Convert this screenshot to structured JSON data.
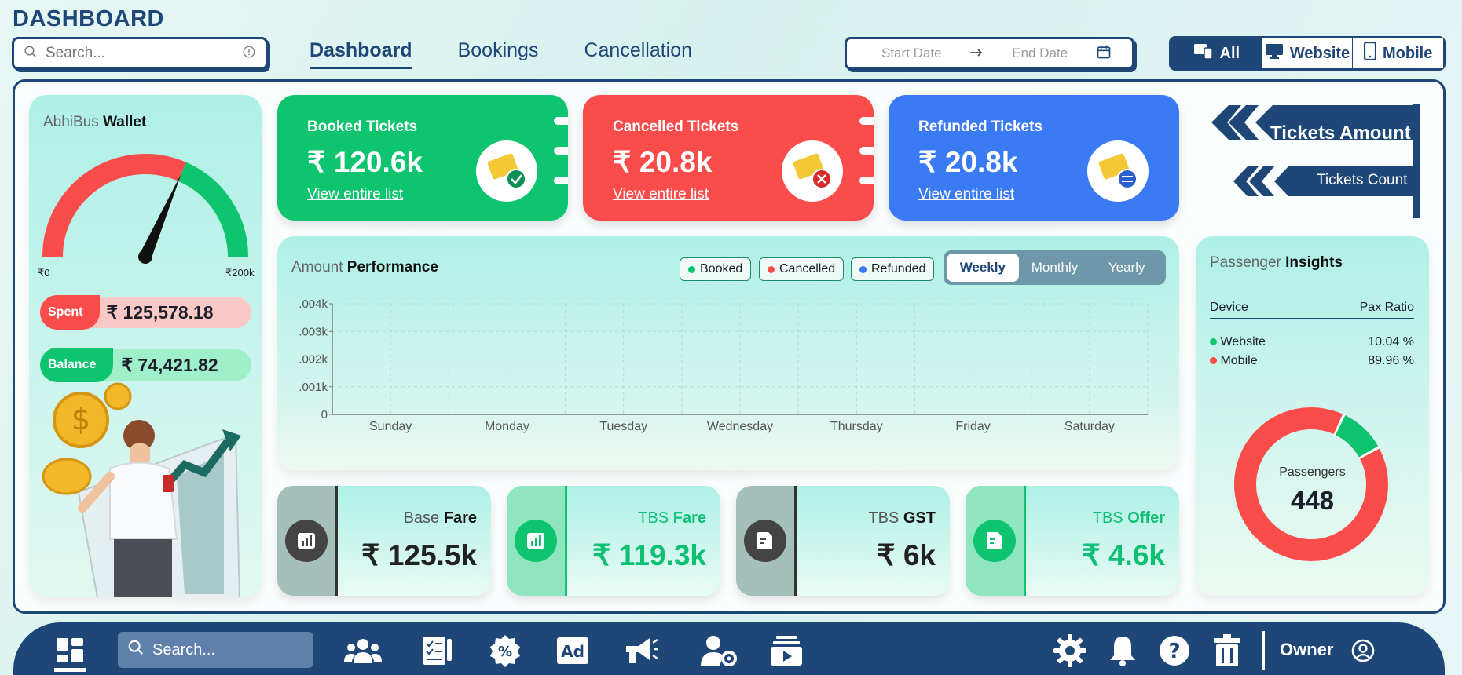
{
  "header": {
    "title": "DASHBOARD",
    "search_placeholder": "Search...",
    "tabs": [
      {
        "label": "Dashboard",
        "active": true
      },
      {
        "label": "Bookings",
        "active": false
      },
      {
        "label": "Cancellation",
        "active": false
      }
    ],
    "start_date_placeholder": "Start Date",
    "end_date_placeholder": "End Date",
    "source_filter": [
      {
        "label": "All",
        "icon": "devices-icon",
        "active": true
      },
      {
        "label": "Website",
        "icon": "monitor-icon",
        "active": false
      },
      {
        "label": "Mobile",
        "icon": "phone-icon",
        "active": false
      }
    ]
  },
  "wallet": {
    "title_prefix": "AbhiBus",
    "title_bold": "Wallet",
    "gauge_min": "₹0",
    "gauge_max": "₹200k",
    "gauge_fraction": 0.63,
    "spent_label": "Spent",
    "spent_value": "₹ 125,578.18",
    "balance_label": "Balance",
    "balance_value": "₹ 74,421.82"
  },
  "stats": [
    {
      "label": "Booked Tickets",
      "value": "₹ 120.6k",
      "link": "View entire list",
      "color": "#0ec46f",
      "icon": "ticket-check-icon"
    },
    {
      "label": "Cancelled Tickets",
      "value": "₹ 20.8k",
      "link": "View entire list",
      "color": "#fa4d4b",
      "icon": "ticket-cancel-icon"
    },
    {
      "label": "Refunded Tickets",
      "value": "₹ 20.8k",
      "link": "View entire list",
      "color": "#3a7bf5",
      "icon": "ticket-refund-icon"
    }
  ],
  "signpost": {
    "primary": "Tickets Amount",
    "secondary": "Tickets Count"
  },
  "performance": {
    "title_prefix": "Amount",
    "title_bold": "Performance",
    "legend": [
      {
        "label": "Booked",
        "color": "#0ec46f"
      },
      {
        "label": "Cancelled",
        "color": "#fa4d4b"
      },
      {
        "label": "Refunded",
        "color": "#3a7bf5"
      }
    ],
    "periods": [
      {
        "label": "Weekly",
        "active": true
      },
      {
        "label": "Monthly",
        "active": false
      },
      {
        "label": "Yearly",
        "active": false
      }
    ]
  },
  "chart_data": {
    "type": "line",
    "categories": [
      "Sunday",
      "Monday",
      "Tuesday",
      "Wednesday",
      "Thursday",
      "Friday",
      "Saturday"
    ],
    "y_ticks": [
      ".004k",
      ".003k",
      ".002k",
      ".001k",
      "0"
    ],
    "ylim": [
      0,
      0.004
    ],
    "grid": true,
    "series": [
      {
        "name": "Booked",
        "values": [
          0,
          0,
          0,
          0,
          0,
          0,
          0
        ]
      },
      {
        "name": "Cancelled",
        "values": [
          0,
          0,
          0,
          0,
          0,
          0,
          0
        ]
      },
      {
        "name": "Refunded",
        "values": [
          0,
          0,
          0,
          0,
          0,
          0,
          0
        ]
      }
    ]
  },
  "fares": [
    {
      "prefix": "Base",
      "bold": "Fare",
      "value": "₹ 125.5k",
      "variant": "gray",
      "icon": "bar-chart-icon"
    },
    {
      "prefix": "TBS",
      "bold": "Fare",
      "value": "₹ 119.3k",
      "variant": "green",
      "icon": "bar-chart-icon"
    },
    {
      "prefix": "TBS",
      "bold": "GST",
      "value": "₹ 6k",
      "variant": "gray",
      "icon": "document-icon"
    },
    {
      "prefix": "TBS",
      "bold": "Offer",
      "value": "₹ 4.6k",
      "variant": "green",
      "icon": "document-icon"
    }
  ],
  "passenger": {
    "title_prefix": "Passenger",
    "title_bold": "Insights",
    "col_device": "Device",
    "col_ratio": "Pax Ratio",
    "rows": [
      {
        "device": "Website",
        "ratio": "10.04 %",
        "color": "#0ec46f"
      },
      {
        "device": "Mobile",
        "ratio": "89.96 %",
        "color": "#fa4d4b"
      }
    ],
    "donut_label": "Passengers",
    "donut_value": "448"
  },
  "bottombar": {
    "search_placeholder": "Search...",
    "owner_label": "Owner"
  },
  "colors": {
    "navy": "#1e4677",
    "green": "#0ec46f",
    "red": "#fa4d4b",
    "blue": "#3a7bf5"
  }
}
